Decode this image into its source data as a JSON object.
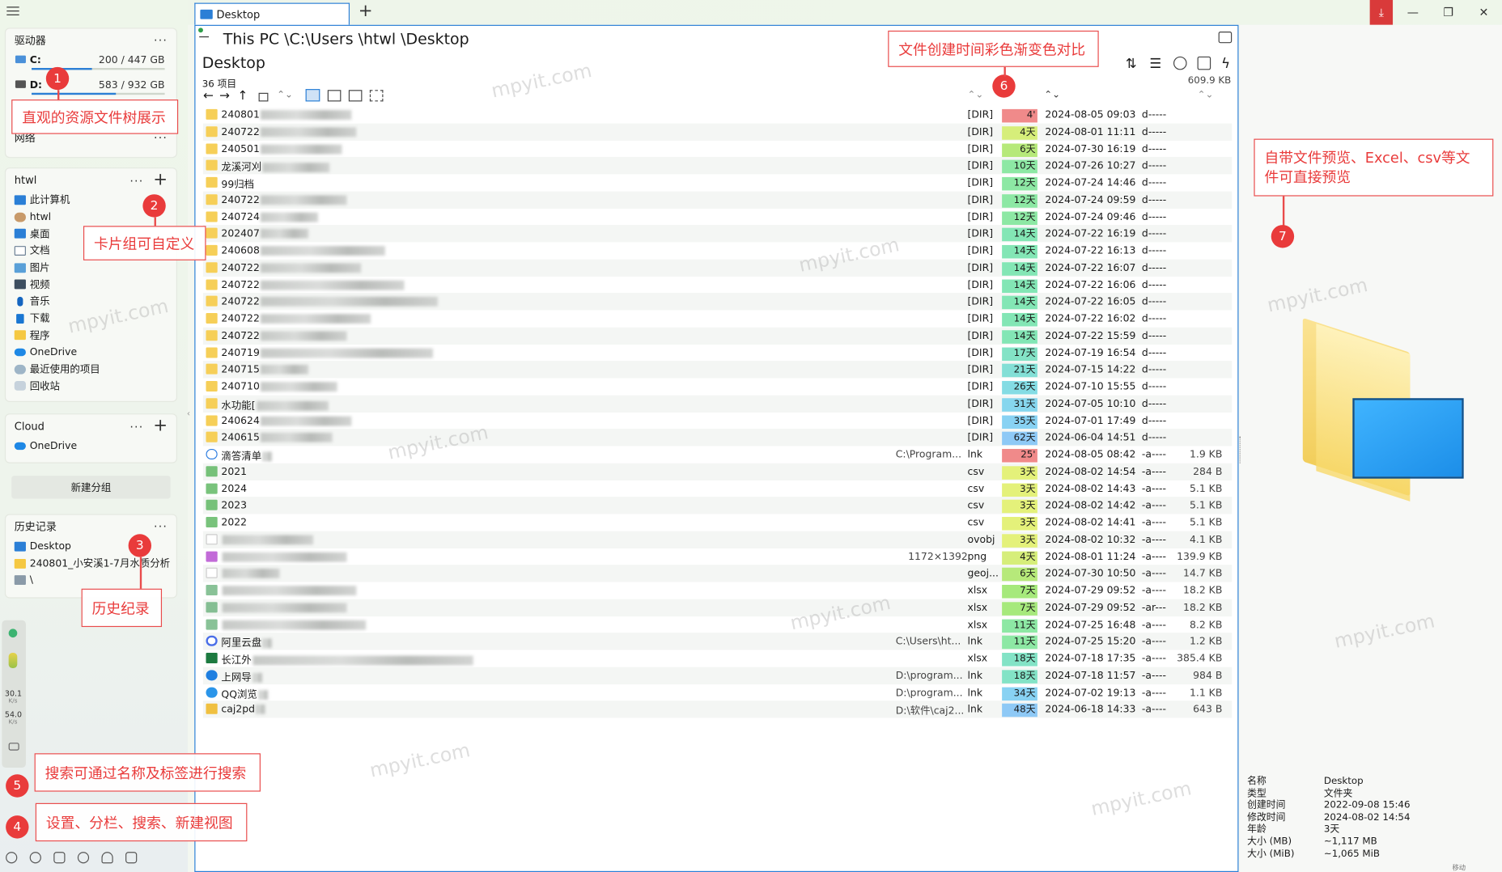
{
  "app": {
    "menu_icon": "hamburger-icon"
  },
  "tab": {
    "label": "Desktop",
    "new_tab": "+"
  },
  "window": {
    "accent": "#2b7fd6",
    "download_btn_color": "#d93a3a"
  },
  "drives": {
    "title": "驱动器",
    "items": [
      {
        "label": "C:",
        "size": "200 / 447 GB",
        "used": 0.45
      },
      {
        "label": "D:",
        "size": "583 / 932 GB",
        "used": 0.63
      }
    ],
    "network": "网络"
  },
  "cards": {
    "htwl": {
      "title": "htwl",
      "items": [
        "此计算机",
        "htwl",
        "桌面",
        "文档",
        "图片",
        "视频",
        "音乐",
        "下载",
        "程序",
        "OneDrive",
        "最近使用的项目",
        "回收站"
      ]
    },
    "cloud": {
      "title": "Cloud",
      "items": [
        "OneDrive"
      ]
    },
    "new_group": "新建分组",
    "history": {
      "title": "历史记录",
      "items": [
        "Desktop",
        "240801_小安溪1-7月水质分析",
        "\\"
      ]
    }
  },
  "speed": {
    "up": "30.1",
    "up_unit": "K/s",
    "down": "54.0",
    "down_unit": "K/s"
  },
  "path": {
    "text": "This PC \\C:\\Users \\htwl \\Desktop"
  },
  "folder": {
    "title": "Desktop",
    "count": "36 项目",
    "total_size": "609.9 KB"
  },
  "files": [
    {
      "name": "240801",
      "type": "[DIR]",
      "age": "4'",
      "age_color": "#f08a8a",
      "date": "2024-08-05  09:03",
      "attr": "d-----",
      "size": "",
      "icon": "folder",
      "blur": 95
    },
    {
      "name": "240722",
      "type": "[DIR]",
      "age": "4天",
      "age_color": "#d6ee7a",
      "date": "2024-08-01  11:11",
      "attr": "d-----",
      "size": "",
      "icon": "folder",
      "blur": 100
    },
    {
      "name": "240501",
      "type": "[DIR]",
      "age": "6天",
      "age_color": "#b6e97a",
      "date": "2024-07-30  16:19",
      "attr": "d-----",
      "size": "",
      "icon": "folder",
      "blur": 85
    },
    {
      "name": "龙溪河刈",
      "type": "[DIR]",
      "age": "10天",
      "age_color": "#8de8a4",
      "date": "2024-07-26  10:27",
      "attr": "d-----",
      "size": "",
      "icon": "folder",
      "blur": 70
    },
    {
      "name": "99归档",
      "type": "[DIR]",
      "age": "12天",
      "age_color": "#8de8a4",
      "date": "2024-07-24  14:46",
      "attr": "d-----",
      "size": "",
      "icon": "folder",
      "blur": 0
    },
    {
      "name": "240722",
      "type": "[DIR]",
      "age": "12天",
      "age_color": "#8de8a4",
      "date": "2024-07-24  09:59",
      "attr": "d-----",
      "size": "",
      "icon": "folder",
      "blur": 90
    },
    {
      "name": "240724",
      "type": "[DIR]",
      "age": "12天",
      "age_color": "#8de8a4",
      "date": "2024-07-24  09:46",
      "attr": "d-----",
      "size": "",
      "icon": "folder",
      "blur": 60
    },
    {
      "name": "202407",
      "type": "[DIR]",
      "age": "14天",
      "age_color": "#83e6b5",
      "date": "2024-07-22  16:19",
      "attr": "d-----",
      "size": "",
      "icon": "folder",
      "blur": 50
    },
    {
      "name": "240608",
      "type": "[DIR]",
      "age": "14天",
      "age_color": "#83e6b5",
      "date": "2024-07-22  16:13",
      "attr": "d-----",
      "size": "",
      "icon": "folder",
      "blur": 130
    },
    {
      "name": "240722",
      "type": "[DIR]",
      "age": "14天",
      "age_color": "#83e6b5",
      "date": "2024-07-22  16:07",
      "attr": "d-----",
      "size": "",
      "icon": "folder",
      "blur": 105
    },
    {
      "name": "240722",
      "type": "[DIR]",
      "age": "14天",
      "age_color": "#83e6b5",
      "date": "2024-07-22  16:06",
      "attr": "d-----",
      "size": "",
      "icon": "folder",
      "blur": 150
    },
    {
      "name": "240722",
      "type": "[DIR]",
      "age": "14天",
      "age_color": "#83e6b5",
      "date": "2024-07-22  16:05",
      "attr": "d-----",
      "size": "",
      "icon": "folder",
      "blur": 185
    },
    {
      "name": "240722",
      "type": "[DIR]",
      "age": "14天",
      "age_color": "#83e6b5",
      "date": "2024-07-22  16:02",
      "attr": "d-----",
      "size": "",
      "icon": "folder",
      "blur": 115
    },
    {
      "name": "240722",
      "type": "[DIR]",
      "age": "14天",
      "age_color": "#83e6b5",
      "date": "2024-07-22  15:59",
      "attr": "d-----",
      "size": "",
      "icon": "folder",
      "blur": 90
    },
    {
      "name": "240719",
      "type": "[DIR]",
      "age": "17天",
      "age_color": "#83e3c6",
      "date": "2024-07-19  16:54",
      "attr": "d-----",
      "size": "",
      "icon": "folder",
      "blur": 180
    },
    {
      "name": "240715",
      "type": "[DIR]",
      "age": "21天",
      "age_color": "#83dfd6",
      "date": "2024-07-15  14:22",
      "attr": "d-----",
      "size": "",
      "icon": "folder",
      "blur": 50
    },
    {
      "name": "240710",
      "type": "[DIR]",
      "age": "26天",
      "age_color": "#84dce4",
      "date": "2024-07-10  15:55",
      "attr": "d-----",
      "size": "",
      "icon": "folder",
      "blur": 80
    },
    {
      "name": "水功能[",
      "type": "[DIR]",
      "age": "31天",
      "age_color": "#86d6ee",
      "date": "2024-07-05  10:10",
      "attr": "d-----",
      "size": "",
      "icon": "folder",
      "blur": 75
    },
    {
      "name": "240624",
      "type": "[DIR]",
      "age": "35天",
      "age_color": "#88d2f3",
      "date": "2024-07-01  17:49",
      "attr": "d-----",
      "size": "",
      "icon": "folder",
      "blur": 95
    },
    {
      "name": "240615",
      "type": "[DIR]",
      "age": "62天",
      "age_color": "#8ec9f6",
      "date": "2024-06-04  14:51",
      "attr": "d-----",
      "size": "",
      "icon": "folder",
      "blur": 75
    },
    {
      "name": "滴答清单",
      "path": "C:\\Program...",
      "type": "lnk",
      "age": "25'",
      "age_color": "#f08a8a",
      "date": "2024-08-05  08:42",
      "attr": "-a----",
      "size": "1.9 KB",
      "icon": "lnk",
      "blur": 10
    },
    {
      "name": "2021",
      "type": "csv",
      "age": "3天",
      "age_color": "#e4f17a",
      "date": "2024-08-02  14:54",
      "attr": "-a----",
      "size": "284 B",
      "icon": "csv",
      "blur": 0
    },
    {
      "name": "2024",
      "type": "csv",
      "age": "3天",
      "age_color": "#e4f17a",
      "date": "2024-08-02  14:43",
      "attr": "-a----",
      "size": "5.1 KB",
      "icon": "csv",
      "blur": 0
    },
    {
      "name": "2023",
      "type": "csv",
      "age": "3天",
      "age_color": "#e4f17a",
      "date": "2024-08-02  14:42",
      "attr": "-a----",
      "size": "5.1 KB",
      "icon": "csv",
      "blur": 0
    },
    {
      "name": "2022",
      "type": "csv",
      "age": "3天",
      "age_color": "#e4f17a",
      "date": "2024-08-02  14:41",
      "attr": "-a----",
      "size": "5.1 KB",
      "icon": "csv",
      "blur": 0
    },
    {
      "name": "",
      "type": "ovobj",
      "age": "3天",
      "age_color": "#e4f17a",
      "date": "2024-08-02  10:32",
      "attr": "-a----",
      "size": "4.1 KB",
      "icon": "blank",
      "blur": 95
    },
    {
      "name": "",
      "path": "1172×1392",
      "type": "png",
      "age": "4天",
      "age_color": "#d6ee7a",
      "date": "2024-08-01  11:24",
      "attr": "-a----",
      "size": "139.9 KB",
      "icon": "png",
      "blur": 130
    },
    {
      "name": "",
      "type": "geoj...",
      "age": "6天",
      "age_color": "#b6e97a",
      "date": "2024-07-30  10:50",
      "attr": "-a----",
      "size": "14.7 KB",
      "icon": "blank",
      "blur": 60
    },
    {
      "name": "",
      "type": "xlsx",
      "age": "7天",
      "age_color": "#a6e97c",
      "date": "2024-07-29  09:52",
      "attr": "-a----",
      "size": "18.2 KB",
      "icon": "xlsxg",
      "blur": 140
    },
    {
      "name": "",
      "type": "xlsx",
      "age": "7天",
      "age_color": "#a6e97c",
      "date": "2024-07-29  09:52",
      "attr": "-ar---",
      "size": "18.2 KB",
      "icon": "xlsxg",
      "blur": 130
    },
    {
      "name": "",
      "type": "xlsx",
      "age": "11天",
      "age_color": "#8de8a4",
      "date": "2024-07-25  16:48",
      "attr": "-a----",
      "size": "8.2 KB",
      "icon": "xlsxg",
      "blur": 150
    },
    {
      "name": "阿里云盘",
      "path": "C:\\Users\\ht...",
      "type": "lnk",
      "age": "11天",
      "age_color": "#8de8a4",
      "date": "2024-07-25  15:20",
      "attr": "-a----",
      "size": "1.2 KB",
      "icon": "ali",
      "blur": 10
    },
    {
      "name": "长江外",
      "type": "xlsx",
      "age": "18天",
      "age_color": "#83e3c6",
      "date": "2024-07-18  17:35",
      "attr": "-a----",
      "size": "385.4 KB",
      "icon": "xlsx",
      "blur": 230
    },
    {
      "name": "上网导",
      "path": "D:\\program...",
      "type": "lnk",
      "age": "18天",
      "age_color": "#83e3c6",
      "date": "2024-07-18  11:57",
      "attr": "-a----",
      "size": "984 B",
      "icon": "ie",
      "blur": 10
    },
    {
      "name": "QQ浏览",
      "path": "D:\\program...",
      "type": "lnk",
      "age": "34天",
      "age_color": "#88d2f3",
      "date": "2024-07-02  19:13",
      "attr": "-a----",
      "size": "1.1 KB",
      "icon": "qq",
      "blur": 10
    },
    {
      "name": "caj2pd",
      "path": "D:\\软件\\caj2...",
      "type": "lnk",
      "age": "48天",
      "age_color": "#8ec9f6",
      "date": "2024-06-18  14:33",
      "attr": "-a----",
      "size": "643 B",
      "icon": "caj",
      "blur": 10
    }
  ],
  "preview": {
    "props": [
      {
        "k": "名称",
        "v": "Desktop"
      },
      {
        "k": "类型",
        "v": "文件夹"
      },
      {
        "k": "创建时间",
        "v": "2022-09-08  15:46"
      },
      {
        "k": "修改时间",
        "v": "2024-08-02  14:54"
      },
      {
        "k": "年龄",
        "v": "3天"
      },
      {
        "k": "大小 (MB)",
        "v": "~1,117 MB"
      },
      {
        "k": "大小 (MiB)",
        "v": "~1,065 MiB"
      }
    ],
    "scroll_hint": "移动"
  },
  "annotations": [
    {
      "n": "1",
      "text": "直观的资源文件树展示"
    },
    {
      "n": "2",
      "text": "卡片组可自定义"
    },
    {
      "n": "3",
      "text": "历史纪录"
    },
    {
      "n": "4",
      "text": "设置、分栏、搜索、新建视图"
    },
    {
      "n": "5",
      "text": "搜索可通过名称及标签进行搜索"
    },
    {
      "n": "6",
      "text": "文件创建时间彩色渐变色对比"
    },
    {
      "n": "7",
      "text": "自带文件预览、Excel、csv等文件可直接预览"
    }
  ],
  "watermark": "mpyit.com"
}
